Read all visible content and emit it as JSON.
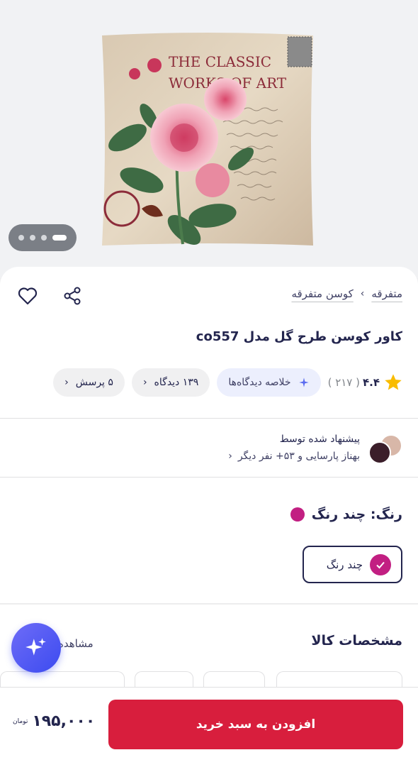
{
  "breadcrumb": {
    "root": "متفرقه",
    "child": "کوسن متفرقه"
  },
  "product": {
    "title": "کاور کوسن طرح گل مدل co557",
    "image_text_line1": "THE CLASSIC",
    "image_text_line2": "WORKS OF ART"
  },
  "rating": {
    "score": "۴.۴",
    "count": "( ۲۱۷ )"
  },
  "chips": {
    "summary": "خلاصه دیدگاه‌ها",
    "comments": "۱۳۹ دیدگاه",
    "questions": "۵ پرسش"
  },
  "recommend": {
    "title": "پیشنهاد شده توسط",
    "people": "بهناز پارسایی و ۵۳+ نفر دیگر"
  },
  "color": {
    "label": "رنگ: چند رنگ",
    "option": "چند رنگ",
    "swatch": "#c21f82"
  },
  "specs": {
    "title": "مشخصات کالا",
    "more": "مشاهده"
  },
  "purchase": {
    "price": "۱۹۵,۰۰۰",
    "currency": "تومان",
    "add_to_cart": "افزودن به سبد خرید"
  },
  "colors": {
    "accent": "#d81e3d",
    "text": "#23254e",
    "magenta": "#c21f82"
  }
}
